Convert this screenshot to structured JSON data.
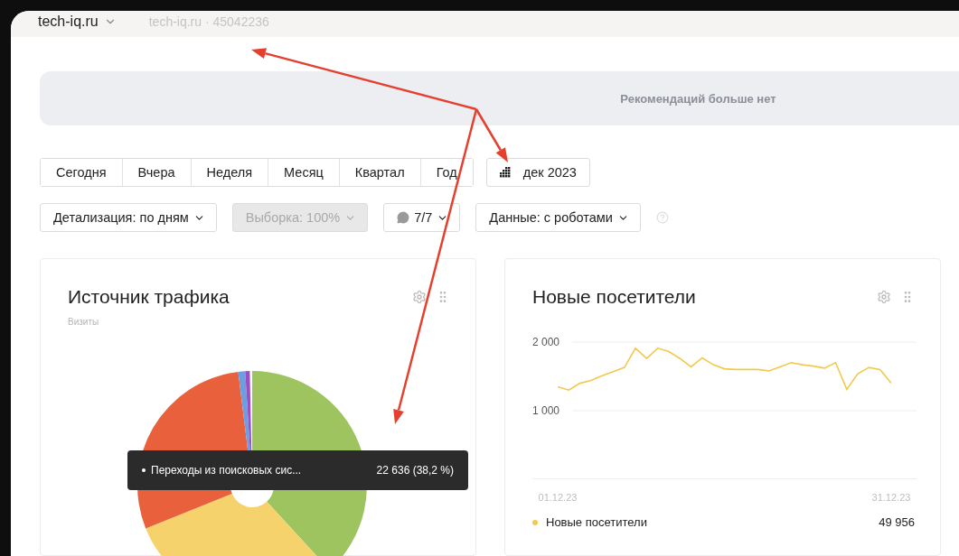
{
  "header": {
    "site": "tech-iq.ru",
    "counter": "tech-iq.ru · 45042236"
  },
  "recommendations": "Рекомендаций больше нет",
  "periods": [
    "Сегодня",
    "Вчера",
    "Неделя",
    "Месяц",
    "Квартал",
    "Год"
  ],
  "date_range": "дек 2023",
  "filters": [
    {
      "kind": "dropdown",
      "label": "Детализация: по дням",
      "disabled": false
    },
    {
      "kind": "dropdown",
      "label": "Выборка: 100%",
      "disabled": true
    },
    {
      "kind": "comments",
      "label": "7/7",
      "disabled": false
    },
    {
      "kind": "dropdown",
      "label": "Данные: с роботами",
      "disabled": false
    },
    {
      "kind": "help"
    }
  ],
  "traffic_card": {
    "title": "Источник трафика",
    "subtitle": "Визиты",
    "tooltip": {
      "label": "Переходы из поисковых сис...",
      "value": "22 636 (38,2 %)"
    }
  },
  "visitors_card": {
    "title": "Новые посетители",
    "chart_data": {
      "type": "line",
      "categories": [
        "01.12.23",
        null,
        null,
        null,
        null,
        null,
        null,
        null,
        null,
        null,
        null,
        null,
        null,
        null,
        null,
        null,
        null,
        null,
        null,
        null,
        null,
        null,
        null,
        null,
        null,
        null,
        null,
        null,
        null,
        null,
        "31.12.23"
      ],
      "ylim": [
        0,
        2000
      ],
      "yticks": [
        {
          "value": 1000,
          "label": "1 000"
        },
        {
          "value": 2000,
          "label": "2 000"
        }
      ],
      "series": [
        {
          "name": "Новые посетители",
          "color": "#f2c94c",
          "values": [
            1350,
            1300,
            1400,
            1440,
            1510,
            1570,
            1630,
            1910,
            1760,
            1910,
            1860,
            1760,
            1640,
            1770,
            1670,
            1610,
            1600,
            1600,
            1600,
            1580,
            1640,
            1700,
            1670,
            1650,
            1620,
            1700,
            1310,
            1540,
            1630,
            1600,
            1400
          ]
        }
      ]
    },
    "legend_value": "49 956"
  }
}
